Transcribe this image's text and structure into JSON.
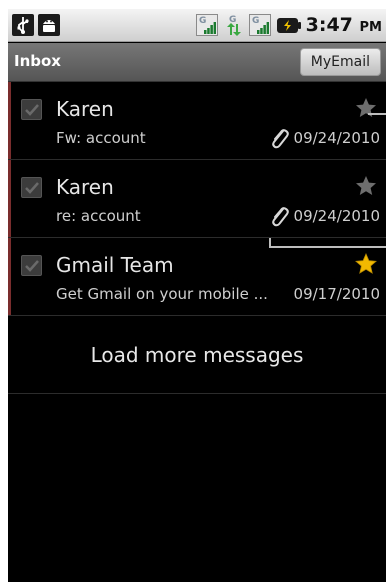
{
  "status_bar": {
    "time": "3:47",
    "ampm": "PM",
    "network_label": "G",
    "icons": [
      "usb-icon",
      "android-debug-icon",
      "signal-icon",
      "data-transfer-icon",
      "signal-icon",
      "battery-icon"
    ]
  },
  "title_bar": {
    "title": "Inbox",
    "button_label": "MyEmail"
  },
  "messages": [
    {
      "from": "Karen",
      "subject": "Fw: account",
      "date": "09/24/2010",
      "starred": false,
      "attachment": true
    },
    {
      "from": "Karen",
      "subject": "re: account",
      "date": "09/24/2010",
      "starred": false,
      "attachment": true
    },
    {
      "from": "Gmail Team",
      "subject": "Get Gmail on your mobile ...",
      "date": "09/17/2010",
      "starred": true,
      "attachment": false
    }
  ],
  "load_more_label": "Load more messages",
  "colors": {
    "background": "#000000",
    "unread_bar": "#7a2d2d",
    "star_active": "#f2b900",
    "star_inactive": "#6e6e6e"
  }
}
